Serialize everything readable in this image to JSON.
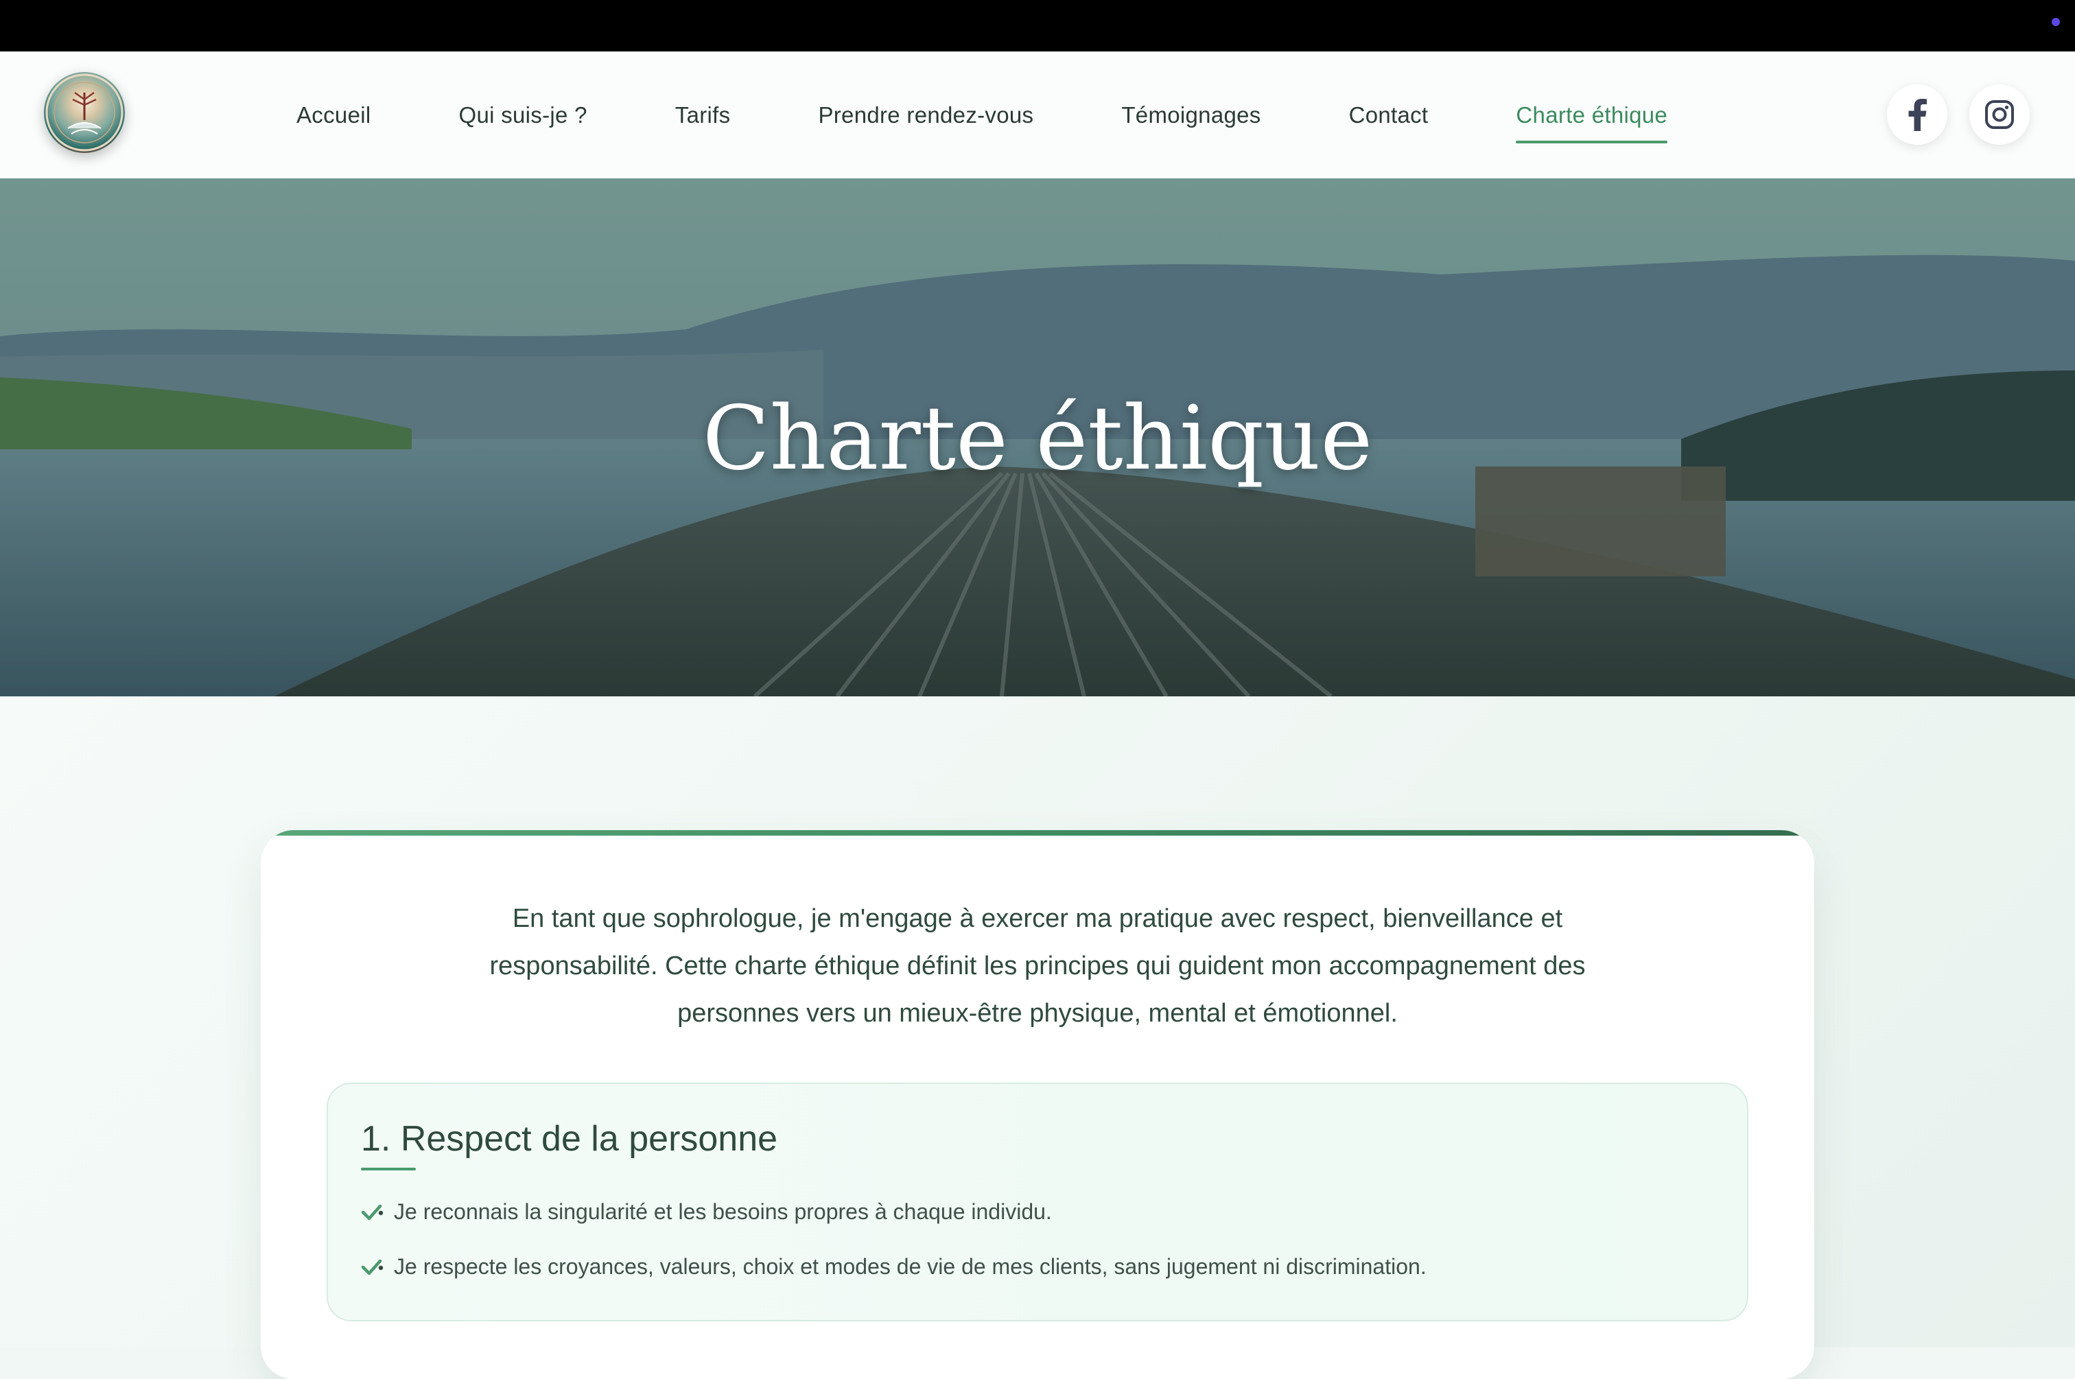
{
  "nav": {
    "items": [
      {
        "label": "Accueil"
      },
      {
        "label": "Qui suis-je ?"
      },
      {
        "label": "Tarifs"
      },
      {
        "label": "Prendre rendez-vous"
      },
      {
        "label": "Témoignages"
      },
      {
        "label": "Contact"
      },
      {
        "label": "Charte éthique",
        "active": true
      }
    ]
  },
  "social": {
    "facebook_icon": "facebook-icon",
    "instagram_icon": "instagram-icon"
  },
  "hero": {
    "title": "Charte éthique"
  },
  "intro": "En tant que sophrologue, je m'engage à exercer ma pratique avec respect, bienveillance et responsabilité. Cette charte éthique définit les principes qui guident mon accompagnement des personnes vers un mieux-être physique, mental et émotionnel.",
  "sections": [
    {
      "title": "1. Respect de la personne",
      "bullets": [
        "Je reconnais la singularité et les besoins propres à chaque individu.",
        "Je respecte les croyances, valeurs, choix et modes de vie de mes clients, sans jugement ni discrimination."
      ]
    }
  ],
  "colors": {
    "accent": "#4a9a6c",
    "text_dark": "#2f4a3e",
    "nav_text": "#2b3a35",
    "active_nav": "#3b8a5f"
  }
}
